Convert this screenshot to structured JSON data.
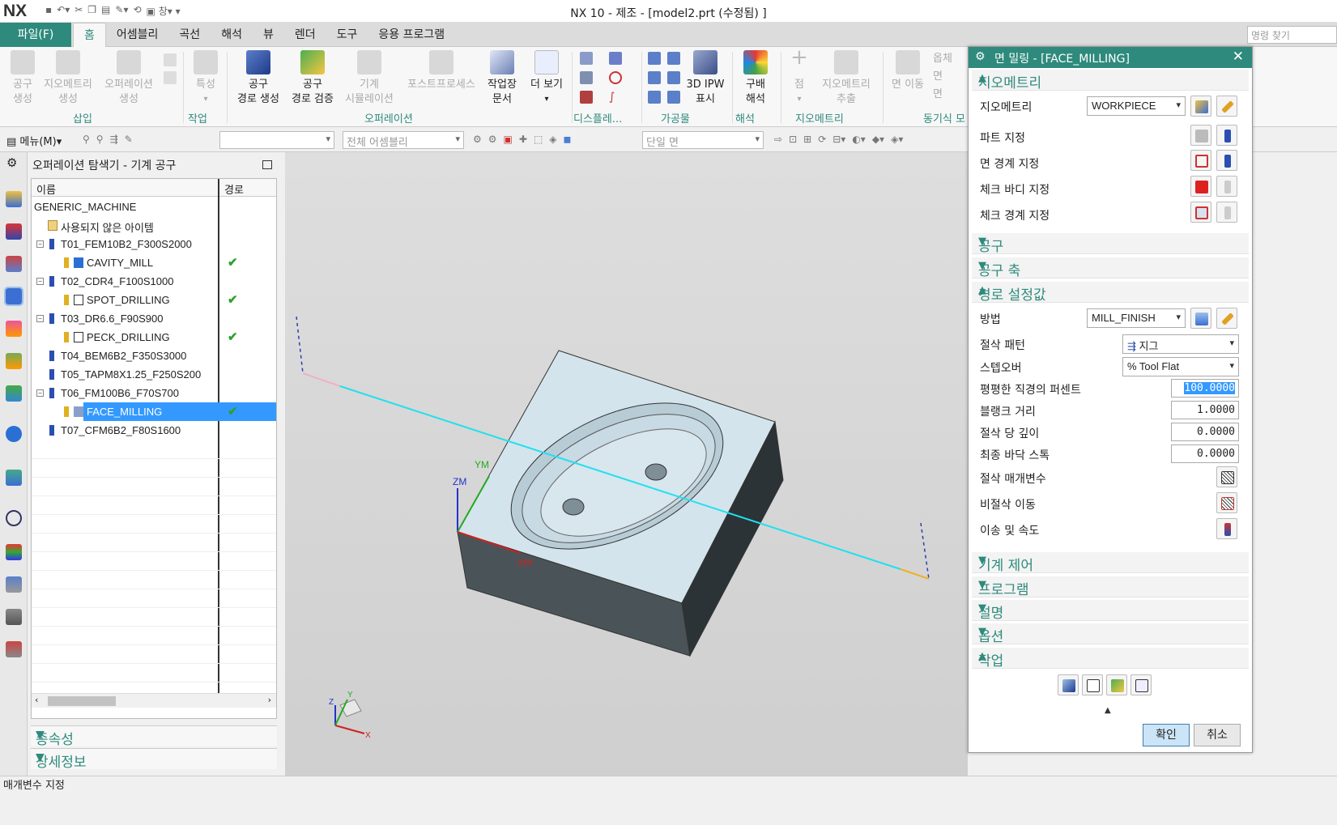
{
  "app": {
    "logo": "NX",
    "window_title": "NX 10 - 제조 - [model2.prt (수정됨) ]",
    "qat_window": "창",
    "search_placeholder": "명령 찾기"
  },
  "tabs": {
    "file": "파일(F)",
    "items": [
      "홈",
      "어셈블리",
      "곡선",
      "해석",
      "뷰",
      "렌더",
      "도구",
      "응용 프로그램"
    ]
  },
  "ribbon": {
    "buttons": [
      {
        "l1": "공구",
        "l2": "생성"
      },
      {
        "l1": "지오메트리",
        "l2": "생성"
      },
      {
        "l1": "오퍼레이션",
        "l2": "생성"
      },
      {
        "l1": "특성",
        "l2": ""
      },
      {
        "l1": "공구",
        "l2": "경로 생성"
      },
      {
        "l1": "공구",
        "l2": "경로 검증"
      },
      {
        "l1": "기계",
        "l2": "시뮬레이션"
      },
      {
        "l1": "포스트프로세스",
        "l2": ""
      },
      {
        "l1": "작업장",
        "l2": "문서"
      },
      {
        "l1": "더 보기",
        "l2": ""
      },
      {
        "l1": "3D IPW",
        "l2": "표시"
      },
      {
        "l1": "구배",
        "l2": "해석"
      },
      {
        "l1": "점",
        "l2": ""
      },
      {
        "l1": "지오메트리",
        "l2": "추출"
      },
      {
        "l1": "면 이동",
        "l2": ""
      }
    ],
    "side_labels": [
      "옵체",
      "면",
      "면"
    ],
    "groups": [
      "삽입",
      "작업",
      "오퍼레이션",
      "디스플레...",
      "가공물",
      "해석",
      "지오메트리",
      "동기식 모"
    ]
  },
  "toolbar2": {
    "menu": "메뉴(M)",
    "combo1": "",
    "combo2": "전체 어셈블리",
    "combo3": "단일 면"
  },
  "navigator": {
    "title": "오퍼레이션 탐색기 - 기계 공구",
    "col_name": "이름",
    "col_path": "경로",
    "rows": [
      {
        "name": "GENERIC_MACHINE",
        "check": ""
      },
      {
        "name": "사용되지 않은 아이템",
        "check": ""
      },
      {
        "name": "T01_FEM10B2_F300S2000",
        "check": ""
      },
      {
        "name": "CAVITY_MILL",
        "check": "✔"
      },
      {
        "name": "T02_CDR4_F100S1000",
        "check": ""
      },
      {
        "name": "SPOT_DRILLING",
        "check": "✔"
      },
      {
        "name": "T03_DR6.6_F90S900",
        "check": ""
      },
      {
        "name": "PECK_DRILLING",
        "check": "✔"
      },
      {
        "name": "T04_BEM6B2_F350S3000",
        "check": ""
      },
      {
        "name": "T05_TAPM8X1.25_F250S200",
        "check": ""
      },
      {
        "name": "T06_FM100B6_F70S700",
        "check": ""
      },
      {
        "name": "FACE_MILLING",
        "check": "✔"
      },
      {
        "name": "T07_CFM6B2_F80S1600",
        "check": ""
      }
    ],
    "sections": [
      "종속성",
      "상세정보"
    ]
  },
  "viewport": {
    "axis_zm": "ZM",
    "axis_ym": "YM",
    "axis_xm": "XM",
    "triad_x": "X",
    "triad_y": "Y",
    "triad_z": "Z"
  },
  "dialog": {
    "title": "면 밀링 - [FACE_MILLING]",
    "sect_geometry": "지오메트리",
    "lbl_geometry": "지오메트리",
    "geometry_value": "WORKPIECE",
    "lbl_part": "파트 지정",
    "lbl_face_boundary": "면 경계 지정",
    "lbl_check_body": "체크 바디 지정",
    "lbl_check_boundary": "체크 경계 지정",
    "sect_tool": "공구",
    "sect_tool_axis": "공구 축",
    "sect_path": "경로 설정값",
    "lbl_method": "방법",
    "method_value": "MILL_FINISH",
    "lbl_cut_pattern": "절삭 패턴",
    "cut_pattern_value": "지그",
    "lbl_stepover": "스텝오버",
    "stepover_value": "% Tool Flat",
    "lbl_flat_pct": "평평한 직경의 퍼센트",
    "flat_pct_value": "100.0000",
    "lbl_blank": "블랭크 거리",
    "blank_value": "1.0000",
    "lbl_depth": "절삭 당 깊이",
    "depth_value": "0.0000",
    "lbl_final_floor": "최종 바닥 스톡",
    "final_floor_value": "0.0000",
    "lbl_cut_params": "절삭 매개변수",
    "lbl_noncut": "비절삭 이동",
    "lbl_feeds": "이송 및 속도",
    "sect_machine": "기계 제어",
    "sect_program": "프로그램",
    "sect_desc": "설명",
    "sect_options": "옵션",
    "sect_actions": "작업",
    "ok": "확인",
    "cancel": "취소"
  },
  "status": "매개변수 지정"
}
